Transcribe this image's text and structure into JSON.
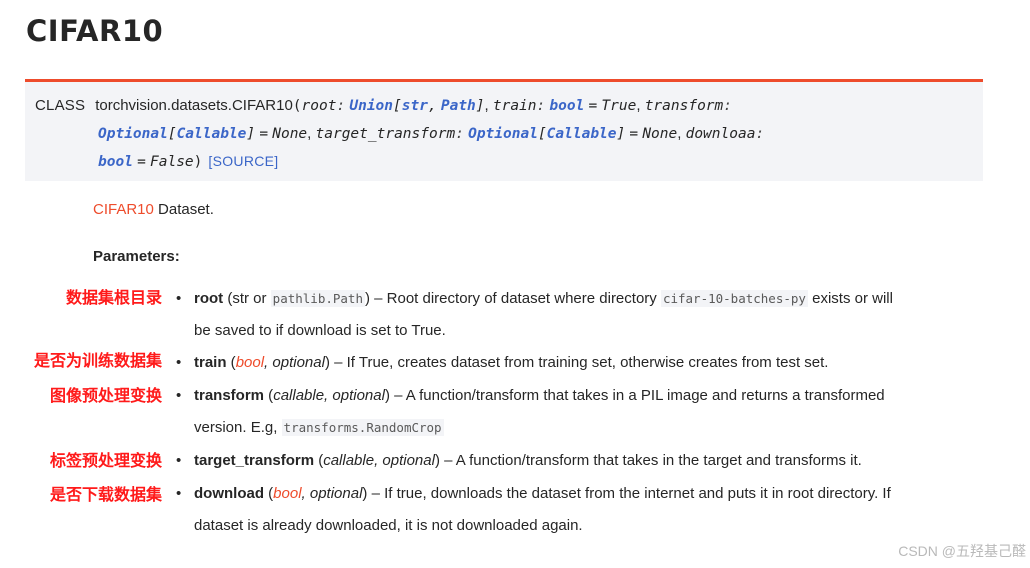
{
  "page": {
    "title": "CIFAR10"
  },
  "signature": {
    "class_label": "CLASS",
    "qualname": "torchvision.datasets.CIFAR10",
    "open_paren": "(",
    "close_paren": ")",
    "p_root": "root",
    "p_root_colon": ":",
    "t_union": "Union",
    "t_union_open": "[",
    "t_str": "str",
    "t_comma": ",",
    "t_path": "Path",
    "t_union_close": "]",
    "sep1": ",",
    "p_train": "train",
    "p_train_colon": ":",
    "t_bool1": "bool",
    "eq1": "=",
    "v_true": "True",
    "sep2": ",",
    "p_transform": "transform",
    "p_transform_colon": ":",
    "t_optional1": "Optional",
    "t_opt1_open": "[",
    "t_callable1": "Callable",
    "t_opt1_close": "]",
    "eq2": "=",
    "v_none1": "None",
    "sep3": ",",
    "p_target_transform": "target_transform",
    "p_target_colon": ":",
    "t_optional2": "Optional",
    "t_opt2_open": "[",
    "t_callable2": "Callable",
    "t_opt2_close": "]",
    "eq3": "=",
    "v_none2": "None",
    "sep4": ",",
    "p_download": "downloaa",
    "p_download_colon": ":",
    "t_bool2": "bool",
    "eq4": "=",
    "v_false": "False",
    "source_link": "[SOURCE]"
  },
  "description": {
    "link": "CIFAR10",
    "text": " Dataset."
  },
  "parameters_heading": "Parameters:",
  "params": [
    {
      "annotation": "数据集根目录",
      "name": "root",
      "open": " (str or ",
      "code": "pathlib.Path",
      "close": ") – Root directory of dataset where directory ",
      "code2": "cifar-10-batches-py",
      "tail": " exists or will",
      "line2": "be saved to if download is set to True."
    },
    {
      "annotation": "是否为训练数据集",
      "name": "train",
      "open": " (",
      "type_link": "bool",
      "type_rest": ", optional",
      "close": ") – If True, creates dataset from training set, otherwise creates from test set."
    },
    {
      "annotation": "图像预处理变换",
      "name": "transform",
      "open": " (",
      "type_text": "callable, optional",
      "close": ") – A function/transform that takes in a PIL image and returns a transformed",
      "line2_prefix": "version. E.g, ",
      "line2_code": "transforms.RandomCrop"
    },
    {
      "annotation": "标签预处理变换",
      "name": "target_transform",
      "open": " (",
      "type_text": "callable, optional",
      "close": ") – A function/transform that takes in the target and transforms it."
    },
    {
      "annotation": "是否下载数据集",
      "name": "download",
      "open": " (",
      "type_link": "bool",
      "type_rest": ", optional",
      "close": ") – If true, downloads the dataset from the internet and puts it in root directory. If",
      "line2": "dataset is already downloaded, it is not downloaded again."
    }
  ],
  "bullet": "•",
  "watermark": "CSDN @五羟基己醛",
  "colors": {
    "accent": "#ee4c2c",
    "type_blue": "#3b66c8",
    "annotation_red": "#ff1a1a",
    "signature_bg": "#f3f4f7"
  }
}
